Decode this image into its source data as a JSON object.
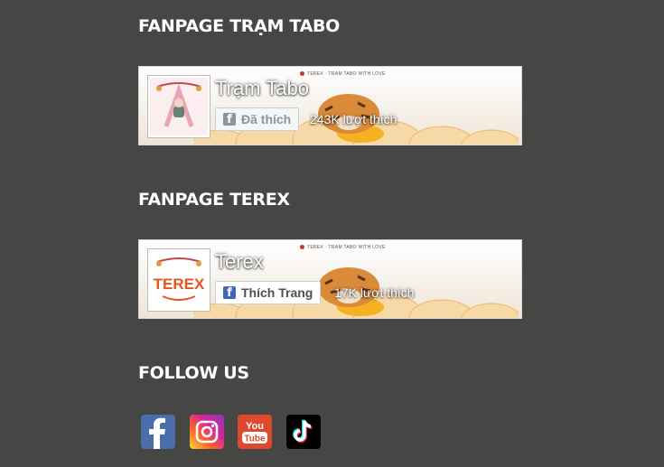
{
  "sections": {
    "fanpage_tabo_title": "FANPAGE TRẠM TABO",
    "fanpage_terex_title": "FANPAGE TEREX",
    "follow_us_title": "FOLLOW US"
  },
  "fanpages": [
    {
      "name": "Trạm Tabo",
      "like_button": "Đã thích",
      "like_count": "243K lượt thích",
      "cover_caption": "TEREX · TRẠM TABO WITH LOVE",
      "button_state": "liked"
    },
    {
      "name": "Terex",
      "like_button": "Thích Trang",
      "like_count": "17K lượt thích",
      "cover_caption": "TEREX · TRẠM TABO WITH LOVE",
      "button_state": "not-liked",
      "avatar_text": "TEREX"
    }
  ],
  "social": [
    {
      "icon": "facebook-icon",
      "color": "#3b5998"
    },
    {
      "icon": "instagram-icon",
      "color": "#d6249f"
    },
    {
      "icon": "youtube-icon",
      "color": "#e0482e",
      "text_top": "You",
      "text_bottom": "Tube"
    },
    {
      "icon": "tiktok-icon",
      "color": "#000000"
    }
  ],
  "colors": {
    "background": "#464644",
    "facebook_blue": "#4267b2"
  }
}
